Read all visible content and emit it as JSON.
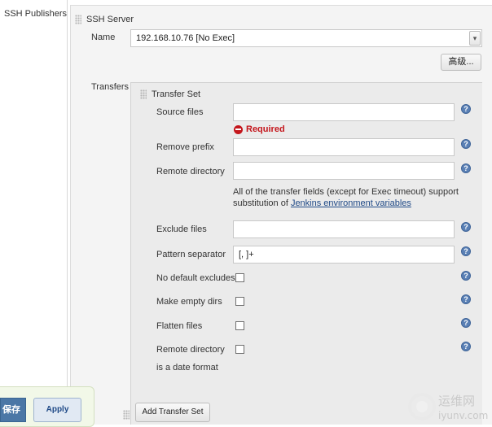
{
  "sidebar": {
    "section_label": "SSH Publishers"
  },
  "ssh_server": {
    "title": "SSH Server",
    "name_label": "Name",
    "name_value": "192.168.10.76 [No Exec]",
    "advanced_button": "高级..."
  },
  "transfers": {
    "label": "Transfers",
    "set_title": "Transfer Set",
    "source_files_label": "Source files",
    "source_files_value": "",
    "required_text": "Required",
    "remove_prefix_label": "Remove prefix",
    "remote_directory_label": "Remote directory",
    "note_text": "All of the transfer fields (except for Exec timeout) support",
    "note_prefix": "substitution of ",
    "note_link": "Jenkins environment variables",
    "exclude_files_label": "Exclude files",
    "pattern_separator_label": "Pattern separator",
    "pattern_separator_value": "[, ]+",
    "no_default_excludes_label": "No default excludes",
    "make_empty_dirs_label": "Make empty dirs",
    "flatten_files_label": "Flatten files",
    "remote_dir_date_label_1": "Remote directory",
    "remote_dir_date_label_2": "is a date format",
    "add_transfer_set_button": "Add Transfer Set"
  },
  "footer": {
    "save_button": "保存",
    "apply_button": "Apply"
  },
  "watermark": {
    "text_cn": "运维网",
    "text_en": "iyunv.com"
  },
  "colors": {
    "help_icon": "#5a80b5",
    "required": "#c4161c",
    "link": "#204a87"
  }
}
